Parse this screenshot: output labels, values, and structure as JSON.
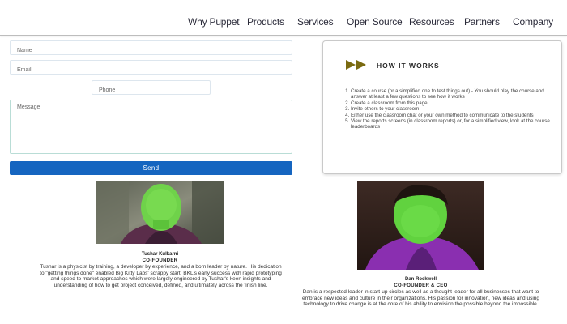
{
  "nav": {
    "items": [
      "Why Puppet",
      "Products",
      "Services",
      "Open Source",
      "Resources",
      "Partners",
      "Company"
    ]
  },
  "form": {
    "name_placeholder": "Name",
    "email_placeholder": "Email",
    "phone_placeholder": "Phone",
    "message_placeholder": "Message",
    "send_label": "Send"
  },
  "how_it_works": {
    "title": "HOW IT WORKS",
    "steps": [
      "Create a course (or a simplified one to test things out) - You should play the course and answer at least a few questions to see how it works",
      "Create a classroom from this page",
      "Invite others to your classroom",
      "Either use the classroom chat or your own method to communicate to the students",
      "View the reports screens (in classroom reports) or, for a simplified view, look at the course leaderboards"
    ],
    "accent_color": "#7a6a10"
  },
  "team": [
    {
      "name": "Tushar Kulkarni",
      "role": "CO-FOUNDER",
      "bio": "Tushar is a physicist by training, a developer by experience, and a born leader by nature. His dedication to \"getting things done\" enabled Big Kitty Labs' scrappy start. BKL's early success with rapid prototyping and speed to market approaches which were largely engineered by Tushar's keen insights and understanding of how to get project conceived, defined, and ultimately across the finish line."
    },
    {
      "name": "Dan Rockwell",
      "role": "CO-FOUNDER & CEO",
      "bio": "Dan is a respected leader in start-up circles as well as a thought leader for all businesses that want to embrace new ideas and culture in their organizations. His passion for innovation, new ideas and using technology to drive change is at the core of his ability to envision the possible beyond the impossible."
    }
  ]
}
